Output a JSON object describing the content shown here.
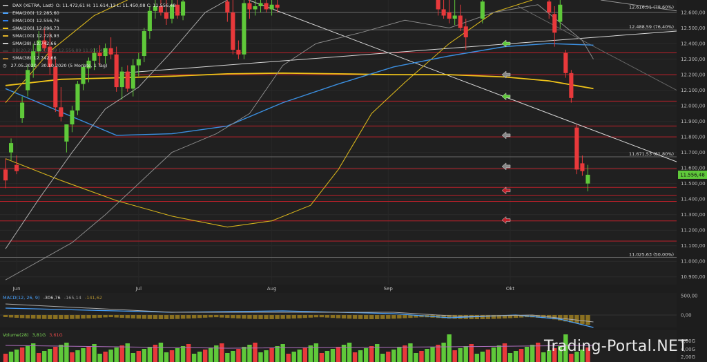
{
  "legend": {
    "instrument": "DAX (XETRA, Last)",
    "ohlc": "O: 11.472,61  H: 11.614,13  L: 11.450,08  C: 11.556,48",
    "items": [
      {
        "label": "EMA(200)",
        "value": "12.285,60",
        "color": "#4aa3ff"
      },
      {
        "label": "EMA(100)",
        "value": "12.556,76",
        "color": "#2f80ed"
      },
      {
        "label": "SMA(200)",
        "value": "12.096,73",
        "color": "#f5c518"
      },
      {
        "label": "SMA(100)",
        "value": "12.728,93",
        "color": "#e0b32a"
      },
      {
        "label": "SMA(38)",
        "value": "12.742,66",
        "color": "#c8c8c8"
      },
      {
        "label": "BB(20,2)",
        "value": "13.037,39  12.556,89  11.935,45",
        "color": "#888888"
      },
      {
        "label": "SMA(38)",
        "value": "12.742,66",
        "color": "#b07d2e"
      }
    ],
    "period": "27.05.2020 - 30.10.2020  (5 Monate, 1 Tag)"
  },
  "macd_label": {
    "title": "MACD(12, 26, 9)",
    "v1": "-306,76",
    "v2": "-165,14",
    "v3": "-141,62"
  },
  "volume_label": {
    "title": "Volume(28)",
    "v1": "3,81G",
    "v2": "3,61G"
  },
  "watermark": "Trading-Portal.NET",
  "current_price": "11.556,48",
  "fib_labels": [
    {
      "text": "12.616,51 (78,60%)",
      "y": 12616.51
    },
    {
      "text": "12.488,59 (76,40%)",
      "y": 12488.59
    },
    {
      "text": "11.671,53 (61,80%)",
      "y": 11671.53
    },
    {
      "text": "11.025,63 (50,00%)",
      "y": 11025.63
    }
  ],
  "chart_data": {
    "type": "candlestick",
    "title": "DAX (XETRA, Last)",
    "y_ticks": [
      "12.600,00",
      "12.500,00",
      "12.400,00",
      "12.300,00",
      "12.200,00",
      "12.100,00",
      "12.000,00",
      "11.900,00",
      "11.800,00",
      "11.700,00",
      "11.600,00",
      "11.500,00",
      "11.400,00",
      "11.300,00",
      "11.200,00",
      "11.100,00",
      "11.000,00",
      "10.900,00"
    ],
    "y_tick_values": [
      12600,
      12500,
      12400,
      12300,
      12200,
      12100,
      12000,
      11900,
      11800,
      11700,
      11600,
      11500,
      11400,
      11300,
      11200,
      11100,
      11000,
      10900
    ],
    "ylim": [
      10850,
      12680
    ],
    "x_ticks": [
      {
        "label": "Jun",
        "index": 2
      },
      {
        "label": "Jul",
        "index": 24
      },
      {
        "label": "Aug",
        "index": 48
      },
      {
        "label": "Sep",
        "index": 69
      },
      {
        "label": "Okt",
        "index": 91
      }
    ],
    "n_bars": 113,
    "horizontal_levels": [
      12600,
      12488.59,
      12340,
      12200,
      12030,
      11870,
      11800,
      11671.53,
      11595,
      11475,
      11425,
      11385,
      11260,
      11130,
      11025.63
    ],
    "red_levels": [
      12340,
      12200,
      12030,
      11870,
      11800,
      11595,
      11475,
      11425,
      11385,
      11260,
      11130
    ],
    "candles": [
      {
        "i": 0,
        "o": 11590,
        "h": 11660,
        "l": 11470,
        "c": 11520
      },
      {
        "i": 1,
        "o": 11700,
        "h": 11790,
        "l": 11650,
        "c": 11760
      },
      {
        "i": 2,
        "o": 11620,
        "h": 11680,
        "l": 11560,
        "c": 11580
      },
      {
        "i": 3,
        "o": 11920,
        "h": 12060,
        "l": 11890,
        "c": 12020
      },
      {
        "i": 4,
        "o": 12100,
        "h": 12260,
        "l": 12060,
        "c": 12230
      },
      {
        "i": 5,
        "o": 12250,
        "h": 12400,
        "l": 12180,
        "c": 12350
      },
      {
        "i": 6,
        "o": 12350,
        "h": 12480,
        "l": 12300,
        "c": 12420
      },
      {
        "i": 7,
        "o": 12420,
        "h": 12500,
        "l": 12350,
        "c": 12370
      },
      {
        "i": 8,
        "o": 12380,
        "h": 12470,
        "l": 12200,
        "c": 12250
      },
      {
        "i": 9,
        "o": 12250,
        "h": 12300,
        "l": 11960,
        "c": 11990
      },
      {
        "i": 10,
        "o": 11990,
        "h": 12120,
        "l": 11900,
        "c": 11930
      },
      {
        "i": 11,
        "o": 11770,
        "h": 11880,
        "l": 11700,
        "c": 11880
      },
      {
        "i": 12,
        "o": 11880,
        "h": 12000,
        "l": 11830,
        "c": 11970
      },
      {
        "i": 13,
        "o": 11970,
        "h": 12160,
        "l": 11940,
        "c": 12140
      },
      {
        "i": 14,
        "o": 12140,
        "h": 12270,
        "l": 12100,
        "c": 12250
      },
      {
        "i": 15,
        "o": 12240,
        "h": 12310,
        "l": 12150,
        "c": 12290
      },
      {
        "i": 16,
        "o": 12290,
        "h": 12370,
        "l": 12230,
        "c": 12340
      },
      {
        "i": 17,
        "o": 12340,
        "h": 12390,
        "l": 12260,
        "c": 12320
      },
      {
        "i": 18,
        "o": 12320,
        "h": 12400,
        "l": 12270,
        "c": 12370
      },
      {
        "i": 19,
        "o": 12370,
        "h": 12440,
        "l": 12300,
        "c": 12330
      },
      {
        "i": 20,
        "o": 12330,
        "h": 12380,
        "l": 12090,
        "c": 12120
      },
      {
        "i": 21,
        "o": 12120,
        "h": 12250,
        "l": 12040,
        "c": 12220
      },
      {
        "i": 22,
        "o": 12220,
        "h": 12260,
        "l": 12090,
        "c": 12110
      },
      {
        "i": 23,
        "o": 12110,
        "h": 12300,
        "l": 12060,
        "c": 12260
      },
      {
        "i": 24,
        "o": 12260,
        "h": 12340,
        "l": 12190,
        "c": 12300
      },
      {
        "i": 25,
        "o": 12320,
        "h": 12500,
        "l": 12280,
        "c": 12480
      },
      {
        "i": 26,
        "o": 12480,
        "h": 12640,
        "l": 12430,
        "c": 12610
      },
      {
        "i": 27,
        "o": 12610,
        "h": 12680,
        "l": 12560,
        "c": 12640
      },
      {
        "i": 28,
        "o": 12640,
        "h": 12680,
        "l": 12580,
        "c": 12600
      },
      {
        "i": 29,
        "o": 12600,
        "h": 12680,
        "l": 12520,
        "c": 12560
      },
      {
        "i": 30,
        "o": 12560,
        "h": 12680,
        "l": 12530,
        "c": 12650
      },
      {
        "i": 31,
        "o": 12650,
        "h": 12680,
        "l": 12560,
        "c": 12580
      },
      {
        "i": 32,
        "o": 12580,
        "h": 12680,
        "l": 12550,
        "c": 12670
      },
      {
        "i": 40,
        "o": 12670,
        "h": 12680,
        "l": 12540,
        "c": 12600
      },
      {
        "i": 41,
        "o": 12600,
        "h": 12680,
        "l": 12330,
        "c": 12360
      },
      {
        "i": 42,
        "o": 12360,
        "h": 12420,
        "l": 12300,
        "c": 12330
      },
      {
        "i": 43,
        "o": 12330,
        "h": 12680,
        "l": 12300,
        "c": 12660
      },
      {
        "i": 44,
        "o": 12660,
        "h": 12680,
        "l": 12560,
        "c": 12620
      },
      {
        "i": 45,
        "o": 12620,
        "h": 12680,
        "l": 12580,
        "c": 12640
      },
      {
        "i": 46,
        "o": 12640,
        "h": 12680,
        "l": 12600,
        "c": 12660
      },
      {
        "i": 47,
        "o": 12660,
        "h": 12680,
        "l": 12600,
        "c": 12620
      },
      {
        "i": 48,
        "o": 12620,
        "h": 12680,
        "l": 12580,
        "c": 12650
      },
      {
        "i": 49,
        "o": 12650,
        "h": 12680,
        "l": 12600,
        "c": 12630
      },
      {
        "i": 78,
        "o": 12680,
        "h": 12680,
        "l": 12580,
        "c": 12620
      },
      {
        "i": 79,
        "o": 12620,
        "h": 12680,
        "l": 12560,
        "c": 12580
      },
      {
        "i": 80,
        "o": 12600,
        "h": 12680,
        "l": 12530,
        "c": 12560
      },
      {
        "i": 81,
        "o": 12560,
        "h": 12680,
        "l": 12520,
        "c": 12580
      },
      {
        "i": 82,
        "o": 12580,
        "h": 12650,
        "l": 12480,
        "c": 12500
      },
      {
        "i": 83,
        "o": 12510,
        "h": 12560,
        "l": 12360,
        "c": 12440
      },
      {
        "i": 86,
        "o": 12560,
        "h": 12680,
        "l": 12530,
        "c": 12670
      },
      {
        "i": 98,
        "o": 12670,
        "h": 12680,
        "l": 12560,
        "c": 12600
      },
      {
        "i": 99,
        "o": 12590,
        "h": 12640,
        "l": 12380,
        "c": 12470
      },
      {
        "i": 100,
        "o": 12540,
        "h": 12680,
        "l": 12500,
        "c": 12650
      },
      {
        "i": 101,
        "o": 12340,
        "h": 12360,
        "l": 12180,
        "c": 12210
      },
      {
        "i": 102,
        "o": 12210,
        "h": 12230,
        "l": 12020,
        "c": 12050
      },
      {
        "i": 103,
        "o": 11860,
        "h": 11880,
        "l": 11560,
        "c": 11590
      },
      {
        "i": 104,
        "o": 11630,
        "h": 11680,
        "l": 11550,
        "c": 11580
      },
      {
        "i": 105,
        "o": 11500,
        "h": 11620,
        "l": 11450,
        "c": 11556.48
      }
    ]
  }
}
